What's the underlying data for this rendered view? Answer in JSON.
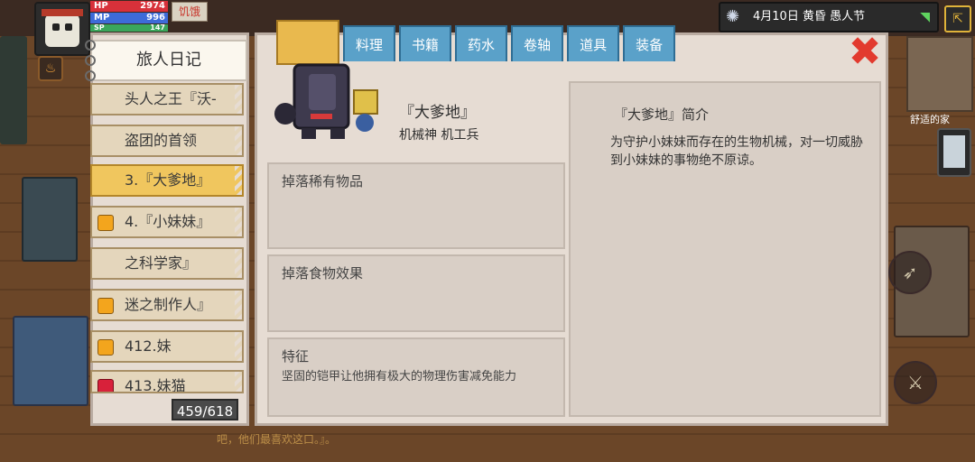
{
  "hud": {
    "hp_label": "HP",
    "hp_value": "2974",
    "mp_label": "MP",
    "mp_value": "996",
    "sp_label": "SP",
    "sp_value": "147",
    "hunger_label": "饥饿"
  },
  "status": {
    "date_text": "4月10日 黄昏 愚人节",
    "minimap_label": "舒适的家"
  },
  "chat_text": "吧，他们最喜欢这口。』。",
  "journal": {
    "title": "旅人日记",
    "count": "459/618",
    "entries": [
      {
        "label": "头人之王『沃-",
        "gem": "",
        "selected": false
      },
      {
        "label": "盗团的首领",
        "gem": "",
        "selected": false
      },
      {
        "label": "3.『大爹地』",
        "gem": "",
        "selected": true
      },
      {
        "label": "4.『小妹妹』",
        "gem": "#f3a51d",
        "selected": false
      },
      {
        "label": "之科学家』",
        "gem": "",
        "selected": false
      },
      {
        "label": "迷之制作人』",
        "gem": "#f3a51d",
        "selected": false
      },
      {
        "label": "412.妹",
        "gem": "#f3a51d",
        "selected": false
      },
      {
        "label": "413.妹猫",
        "gem": "#d8213a",
        "selected": false
      }
    ]
  },
  "tabs": [
    "料理",
    "书籍",
    "药水",
    "卷轴",
    "道具",
    "装备"
  ],
  "enemy": {
    "name": "『大爹地』",
    "type": "机械神 机工兵",
    "drops_title": "掉落稀有物品",
    "food_title": "掉落食物效果",
    "feature_title": "特征",
    "feature_text": "坚固的铠甲让他拥有极大的物理伤害减免能力",
    "desc_title": "『大爹地』简介",
    "desc_text": "为守护小妹妹而存在的生物机械，对一切威胁到小妹妹的事物绝不原谅。"
  },
  "colors": {
    "hp": "#d8313a",
    "mp": "#3d6bd8",
    "sp": "#3aa65b",
    "accent": "#e9b94e",
    "tab": "#5aa1c9",
    "close": "#e23a2e"
  }
}
